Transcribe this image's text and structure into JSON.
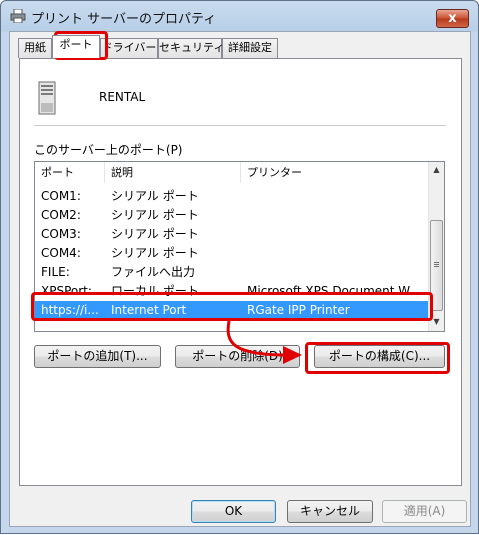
{
  "window": {
    "title": "プリント サーバーのプロパティ",
    "close_label": "x"
  },
  "tabs": [
    {
      "label": "用紙"
    },
    {
      "label": "ポート"
    },
    {
      "label": "ドライバー"
    },
    {
      "label": "セキュリティ"
    },
    {
      "label": "詳細設定"
    }
  ],
  "server": {
    "name": "RENTAL"
  },
  "ports_section": {
    "label": "このサーバー上のポート(P)",
    "columns": [
      "ポート",
      "説明",
      "プリンター"
    ],
    "rows": [
      {
        "port": "COM1:",
        "desc": "シリアル ポート",
        "printer": ""
      },
      {
        "port": "COM2:",
        "desc": "シリアル ポート",
        "printer": ""
      },
      {
        "port": "COM3:",
        "desc": "シリアル ポート",
        "printer": ""
      },
      {
        "port": "COM4:",
        "desc": "シリアル ポート",
        "printer": ""
      },
      {
        "port": "FILE:",
        "desc": "ファイルへ出力",
        "printer": ""
      },
      {
        "port": "XPSPort:",
        "desc": "ローカル ポート",
        "printer": "Microsoft XPS Document W..."
      },
      {
        "port": "https://i...",
        "desc": "Internet Port",
        "printer": "RGate IPP Printer"
      }
    ],
    "selected_row": 6
  },
  "actions": {
    "add_port": "ポートの追加(T)...",
    "delete_port": "ポートの削除(D)",
    "configure_port": "ポートの構成(C)..."
  },
  "footer": {
    "ok": "OK",
    "cancel": "キャンセル",
    "apply": "適用(A)"
  },
  "colors": {
    "highlight": "#e10000",
    "selection": "#3399ff"
  },
  "icons": {
    "title": "printer-icon",
    "server": "server-icon"
  }
}
